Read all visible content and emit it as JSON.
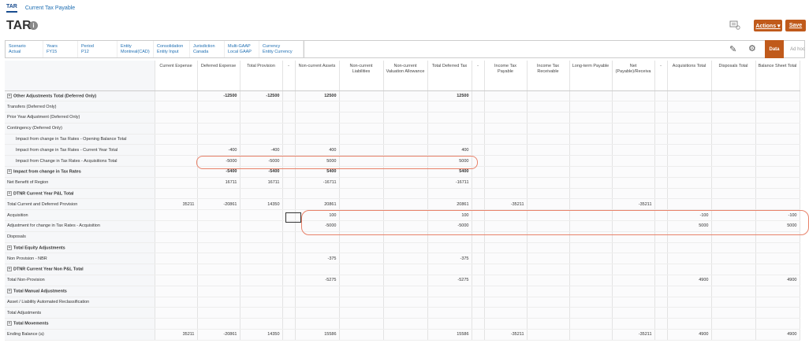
{
  "tabs": [
    {
      "label": "TAR",
      "active": true
    },
    {
      "label": "Current Tax Payable",
      "active": false
    }
  ],
  "header": {
    "title": "TAR",
    "actions_label": "Actions ▾",
    "save_label": "Save"
  },
  "pov": [
    {
      "label": "Scenario",
      "value": "Actual"
    },
    {
      "label": "Years",
      "value": "FY15"
    },
    {
      "label": "Period",
      "value": "P12"
    },
    {
      "label": "Entity",
      "value": "Montreal(CAD)"
    },
    {
      "label": "Consolidation",
      "value": "Entity Input"
    },
    {
      "label": "Jurisdiction",
      "value": "Canada"
    },
    {
      "label": "Multi-GAAP",
      "value": "Local GAAP"
    },
    {
      "label": "Currency",
      "value": "Entity Currency"
    }
  ],
  "toolbar": {
    "data_label": "Data",
    "adhoc_label": "Ad hoc"
  },
  "columns": [
    "Current Expense",
    "Deferred Expense",
    "Total Provision",
    "-",
    "Non-current Assets",
    "Non-current Liabilities",
    "Non-current Valuation Allowance",
    "Total Deferred Tax",
    "-",
    "Income Tax Payable",
    "Income Tax Receivable",
    "Long-term Payable",
    "Net (Payable)/Receiva",
    "-",
    "Acquisitions Total",
    "Disposals Total",
    "Balance Sheet Total"
  ],
  "rows": [
    {
      "label": "Other Adjustments Total (Deferred Only)",
      "bold": true,
      "expand": true,
      "indent": false,
      "cells": [
        "",
        "-12500",
        "-12500",
        "",
        "12500",
        "",
        "",
        "12500",
        "",
        "",
        "",
        "",
        "",
        "",
        "",
        "",
        ""
      ]
    },
    {
      "label": "Transfers (Deferred Only)",
      "bold": false,
      "expand": false,
      "indent": false,
      "cells": [
        "",
        "",
        "",
        "",
        "",
        "",
        "",
        "",
        "",
        "",
        "",
        "",
        "",
        "",
        "",
        "",
        ""
      ]
    },
    {
      "label": "Prior Year Adjustment (Deferred Only)",
      "bold": false,
      "expand": false,
      "indent": false,
      "cells": [
        "",
        "",
        "",
        "",
        "",
        "",
        "",
        "",
        "",
        "",
        "",
        "",
        "",
        "",
        "",
        "",
        ""
      ]
    },
    {
      "label": "Contingency (Deferred Only)",
      "bold": false,
      "expand": false,
      "indent": false,
      "cells": [
        "",
        "",
        "",
        "",
        "",
        "",
        "",
        "",
        "",
        "",
        "",
        "",
        "",
        "",
        "",
        "",
        ""
      ]
    },
    {
      "label": "Impact from change in Tax Rates - Opening Balance Total",
      "bold": false,
      "expand": false,
      "indent": true,
      "cells": [
        "",
        "",
        "",
        "",
        "",
        "",
        "",
        "",
        "",
        "",
        "",
        "",
        "",
        "",
        "",
        "",
        ""
      ]
    },
    {
      "label": "Impact from change in Tax Rates - Current Year Total",
      "bold": false,
      "expand": false,
      "indent": true,
      "cells": [
        "",
        "-400",
        "-400",
        "",
        "400",
        "",
        "",
        "400",
        "",
        "",
        "",
        "",
        "",
        "",
        "",
        "",
        ""
      ]
    },
    {
      "label": "Impact from Change in Tax Rates - Acquisitions Total",
      "bold": false,
      "expand": false,
      "indent": true,
      "cells": [
        "",
        "-5000",
        "-5000",
        "",
        "5000",
        "",
        "",
        "5000",
        "",
        "",
        "",
        "",
        "",
        "",
        "",
        "",
        ""
      ]
    },
    {
      "label": "Impact from change in Tax Rates",
      "bold": true,
      "expand": true,
      "indent": false,
      "cells": [
        "",
        "-5400",
        "-5400",
        "",
        "5400",
        "",
        "",
        "5400",
        "",
        "",
        "",
        "",
        "",
        "",
        "",
        "",
        ""
      ]
    },
    {
      "label": "Net Benefit of Region",
      "bold": false,
      "expand": false,
      "indent": false,
      "cells": [
        "",
        "16711",
        "16711",
        "",
        "-16711",
        "",
        "",
        "-16711",
        "",
        "",
        "",
        "",
        "",
        "",
        "",
        "",
        ""
      ]
    },
    {
      "label": "DTNR Current Year P&L Total",
      "bold": true,
      "expand": true,
      "indent": false,
      "cells": [
        "",
        "",
        "",
        "",
        "",
        "",
        "",
        "",
        "",
        "",
        "",
        "",
        "",
        "",
        "",
        "",
        ""
      ]
    },
    {
      "label": "Total Current and Deferred Provision",
      "bold": false,
      "expand": false,
      "indent": false,
      "cells": [
        "35211",
        "-20861",
        "14350",
        "",
        "20861",
        "",
        "",
        "20861",
        "",
        "-35211",
        "",
        "",
        "-35211",
        "",
        "",
        "",
        ""
      ]
    },
    {
      "label": "Acquisition",
      "bold": false,
      "expand": false,
      "indent": false,
      "cells": [
        "",
        "",
        "",
        "",
        "100",
        "",
        "",
        "100",
        "",
        "",
        "",
        "",
        "",
        "",
        "-100",
        "",
        "-100"
      ]
    },
    {
      "label": "Adjustment for change in Tax Rates - Acquisition",
      "bold": false,
      "expand": false,
      "indent": false,
      "cells": [
        "",
        "",
        "",
        "",
        "-5000",
        "",
        "",
        "-5000",
        "",
        "",
        "",
        "",
        "",
        "",
        "5000",
        "",
        "5000"
      ]
    },
    {
      "label": "Disposals",
      "bold": false,
      "expand": false,
      "indent": false,
      "cells": [
        "",
        "",
        "",
        "",
        "",
        "",
        "",
        "",
        "",
        "",
        "",
        "",
        "",
        "",
        "",
        "",
        ""
      ]
    },
    {
      "label": "Total Equity Adjustments",
      "bold": true,
      "expand": true,
      "indent": false,
      "cells": [
        "",
        "",
        "",
        "",
        "",
        "",
        "",
        "",
        "",
        "",
        "",
        "",
        "",
        "",
        "",
        "",
        ""
      ]
    },
    {
      "label": "Non Provision - NBR",
      "bold": false,
      "expand": false,
      "indent": false,
      "cells": [
        "",
        "",
        "",
        "",
        "-375",
        "",
        "",
        "-375",
        "",
        "",
        "",
        "",
        "",
        "",
        "",
        "",
        ""
      ]
    },
    {
      "label": "DTNR Current Year Non P&L Total",
      "bold": true,
      "expand": true,
      "indent": false,
      "cells": [
        "",
        "",
        "",
        "",
        "",
        "",
        "",
        "",
        "",
        "",
        "",
        "",
        "",
        "",
        "",
        "",
        ""
      ]
    },
    {
      "label": "Total Non-Provision",
      "bold": false,
      "expand": false,
      "indent": false,
      "cells": [
        "",
        "",
        "",
        "",
        "-5275",
        "",
        "",
        "-5275",
        "",
        "",
        "",
        "",
        "",
        "",
        "4900",
        "",
        "4900"
      ]
    },
    {
      "label": "Total Manual Adjustments",
      "bold": true,
      "expand": true,
      "indent": false,
      "cells": [
        "",
        "",
        "",
        "",
        "",
        "",
        "",
        "",
        "",
        "",
        "",
        "",
        "",
        "",
        "",
        "",
        ""
      ]
    },
    {
      "label": "Asset / Liability Automated Reclassification",
      "bold": false,
      "expand": false,
      "indent": false,
      "cells": [
        "",
        "",
        "",
        "",
        "",
        "",
        "",
        "",
        "",
        "",
        "",
        "",
        "",
        "",
        "",
        "",
        ""
      ]
    },
    {
      "label": "Total Adjustments",
      "bold": false,
      "expand": false,
      "indent": false,
      "cells": [
        "",
        "",
        "",
        "",
        "",
        "",
        "",
        "",
        "",
        "",
        "",
        "",
        "",
        "",
        "",
        "",
        ""
      ]
    },
    {
      "label": "Total Movements",
      "bold": true,
      "expand": true,
      "indent": false,
      "cells": [
        "",
        "",
        "",
        "",
        "",
        "",
        "",
        "",
        "",
        "",
        "",
        "",
        "",
        "",
        "",
        "",
        ""
      ]
    },
    {
      "label": "Ending Balance (a)",
      "bold": false,
      "expand": false,
      "indent": false,
      "cells": [
        "35211",
        "-20861",
        "14350",
        "",
        "15586",
        "",
        "",
        "15586",
        "",
        "-35211",
        "",
        "",
        "-35211",
        "",
        "4900",
        "",
        "4900"
      ]
    }
  ],
  "colors": {
    "accent": "#c05a1b",
    "link": "#1f6fb3",
    "highlight": "#e8826a"
  }
}
